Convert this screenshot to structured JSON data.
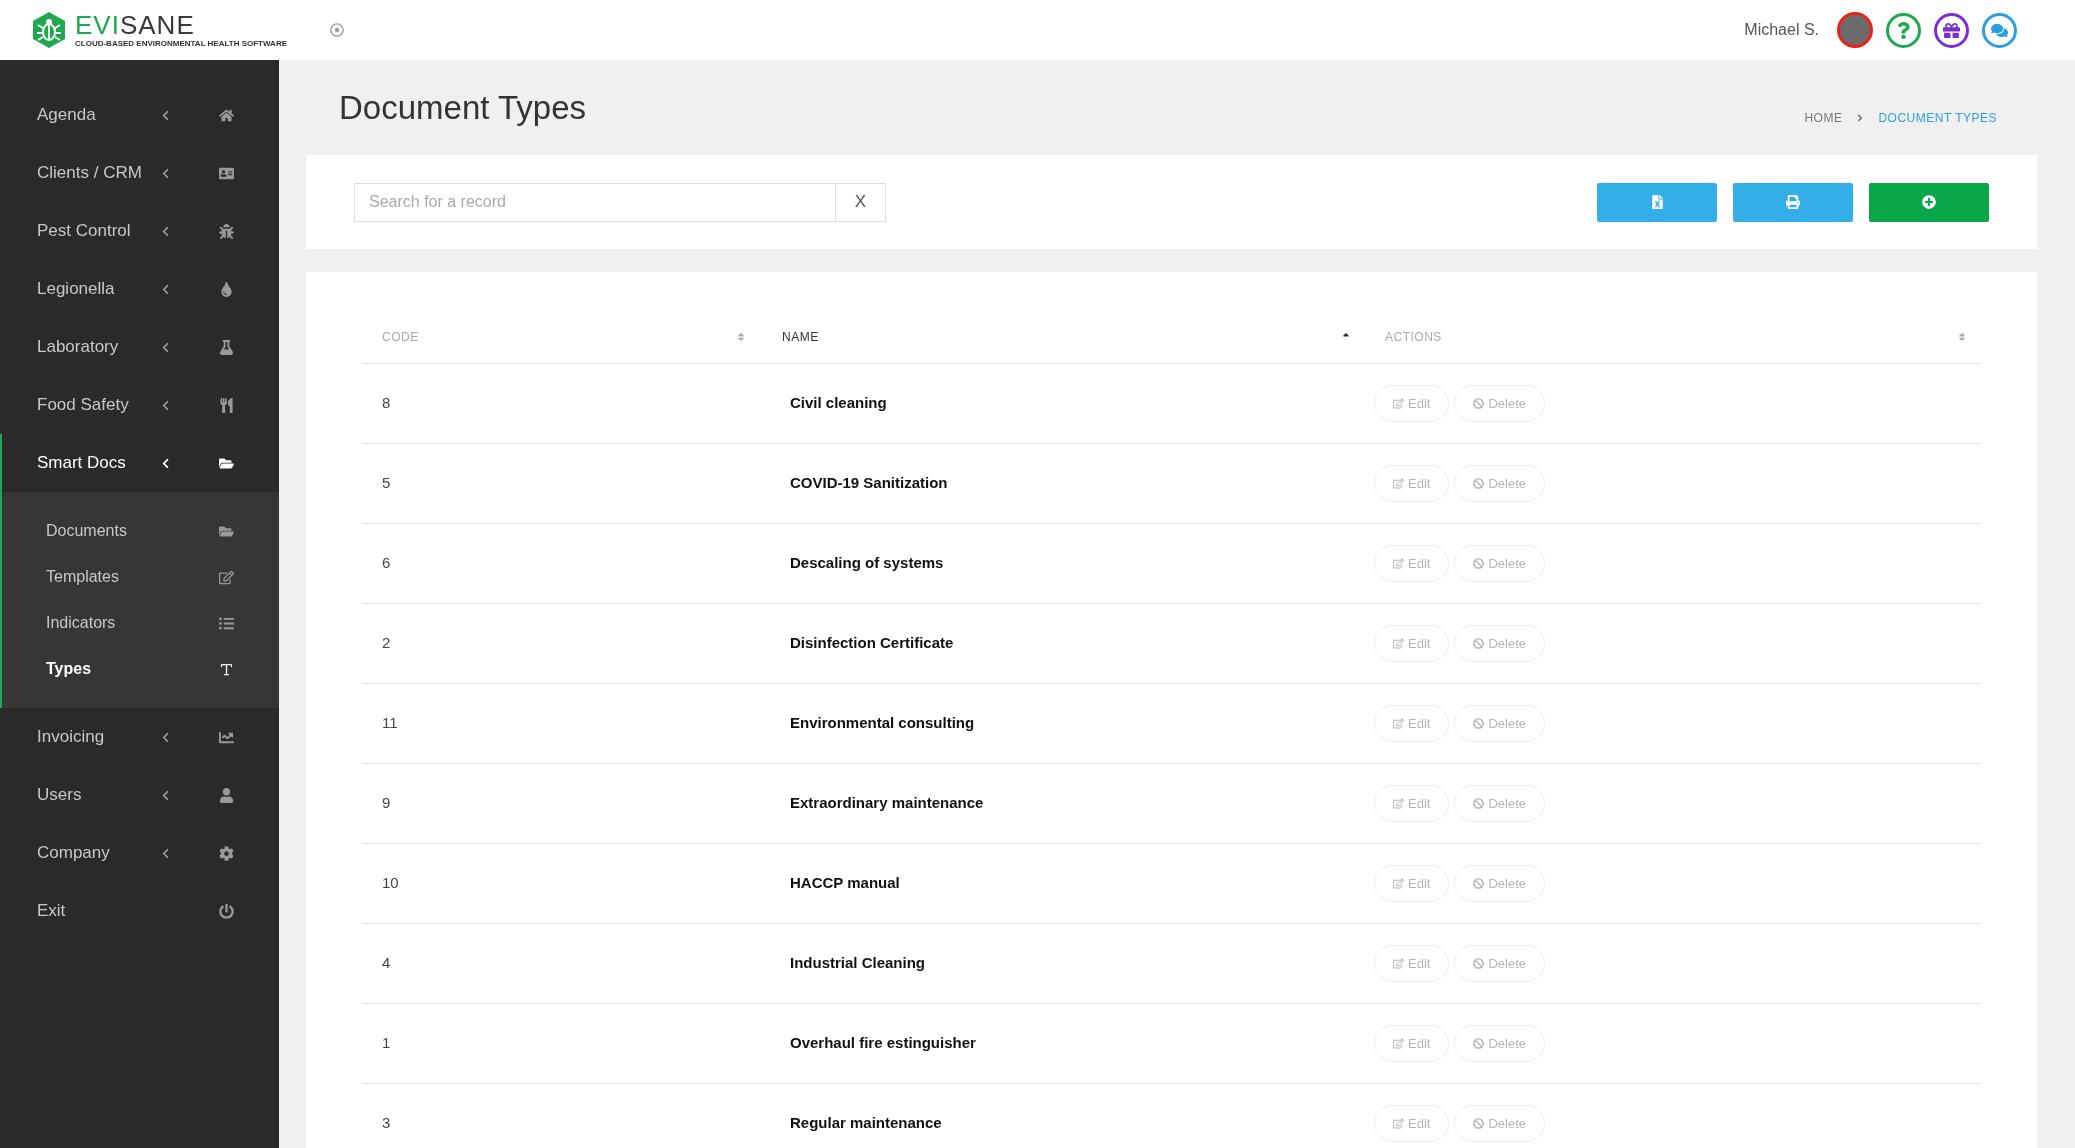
{
  "logo": {
    "brand_accent": "EVI",
    "brand_rest": "SANE",
    "tagline": "CLOUD-BASED ENVIRONMENTAL HEALTH SOFTWARE"
  },
  "user": {
    "name": "Michael S."
  },
  "sidebar": {
    "items": [
      {
        "label": "Agenda",
        "has_submenu": true,
        "selected": false
      },
      {
        "label": "Clients / CRM",
        "has_submenu": true,
        "selected": false
      },
      {
        "label": "Pest Control",
        "has_submenu": true,
        "selected": false
      },
      {
        "label": "Legionella",
        "has_submenu": true,
        "selected": false
      },
      {
        "label": "Laboratory",
        "has_submenu": true,
        "selected": false
      },
      {
        "label": "Food Safety",
        "has_submenu": true,
        "selected": false
      },
      {
        "label": "Smart Docs",
        "has_submenu": true,
        "selected": true,
        "expanded": true,
        "children": [
          {
            "label": "Documents",
            "selected": false
          },
          {
            "label": "Templates",
            "selected": false
          },
          {
            "label": "Indicators",
            "selected": false
          },
          {
            "label": "Types",
            "selected": true
          }
        ]
      },
      {
        "label": "Invoicing",
        "has_submenu": true,
        "selected": false
      },
      {
        "label": "Users",
        "has_submenu": true,
        "selected": false
      },
      {
        "label": "Company",
        "has_submenu": true,
        "selected": false
      },
      {
        "label": "Exit",
        "has_submenu": false,
        "selected": false
      }
    ]
  },
  "page": {
    "title": "Document Types",
    "breadcrumb": [
      {
        "label": "HOME",
        "current": false
      },
      {
        "label": "DOCUMENT TYPES",
        "current": true
      }
    ]
  },
  "search": {
    "placeholder": "Search for a record",
    "clear": "X"
  },
  "table": {
    "columns": [
      {
        "label": "CODE",
        "selected": false
      },
      {
        "label": "NAME",
        "selected": true
      },
      {
        "label": "ACTIONS",
        "selected": false
      }
    ],
    "rows": [
      {
        "code": "8",
        "name": "Civil cleaning",
        "actions": [
          "Edit",
          "Delete"
        ]
      },
      {
        "code": "5",
        "name": "COVID-19 Sanitization",
        "actions": [
          "Edit",
          "Delete"
        ]
      },
      {
        "code": "6",
        "name": "Descaling of systems",
        "actions": [
          "Edit",
          "Delete"
        ]
      },
      {
        "code": "2",
        "name": "Disinfection Certificate",
        "actions": [
          "Edit",
          "Delete"
        ]
      },
      {
        "code": "11",
        "name": "Environmental consulting",
        "actions": [
          "Edit",
          "Delete"
        ]
      },
      {
        "code": "9",
        "name": "Extraordinary maintenance",
        "actions": [
          "Edit",
          "Delete"
        ]
      },
      {
        "code": "10",
        "name": "HACCP manual",
        "actions": [
          "Edit",
          "Delete"
        ]
      },
      {
        "code": "4",
        "name": "Industrial Cleaning",
        "actions": [
          "Edit",
          "Delete"
        ]
      },
      {
        "code": "1",
        "name": "Overhaul fire estinguisher",
        "actions": [
          "Edit",
          "Delete"
        ]
      },
      {
        "code": "3",
        "name": "Regular maintenance",
        "actions": [
          "Edit",
          "Delete"
        ]
      }
    ]
  }
}
